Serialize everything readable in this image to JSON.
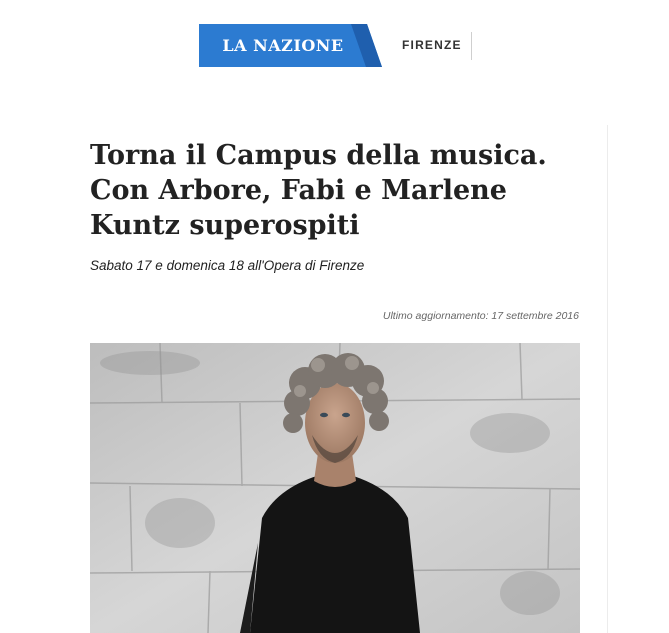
{
  "header": {
    "brand": "LA NAZIONE",
    "city": "FIRENZE",
    "brand_color": "#2c7bd1"
  },
  "article": {
    "title": "Torna il Campus della musica. Con Arbore, Fabi e Marlene Kuntz superospiti",
    "subtitle": "Sabato 17 e domenica 18 all'Opera di Firenze",
    "updated": "Ultimo aggiornamento: 17 settembre 2016",
    "photo_subject": "man with curly grey hair in black t-shirt against stone wall"
  }
}
